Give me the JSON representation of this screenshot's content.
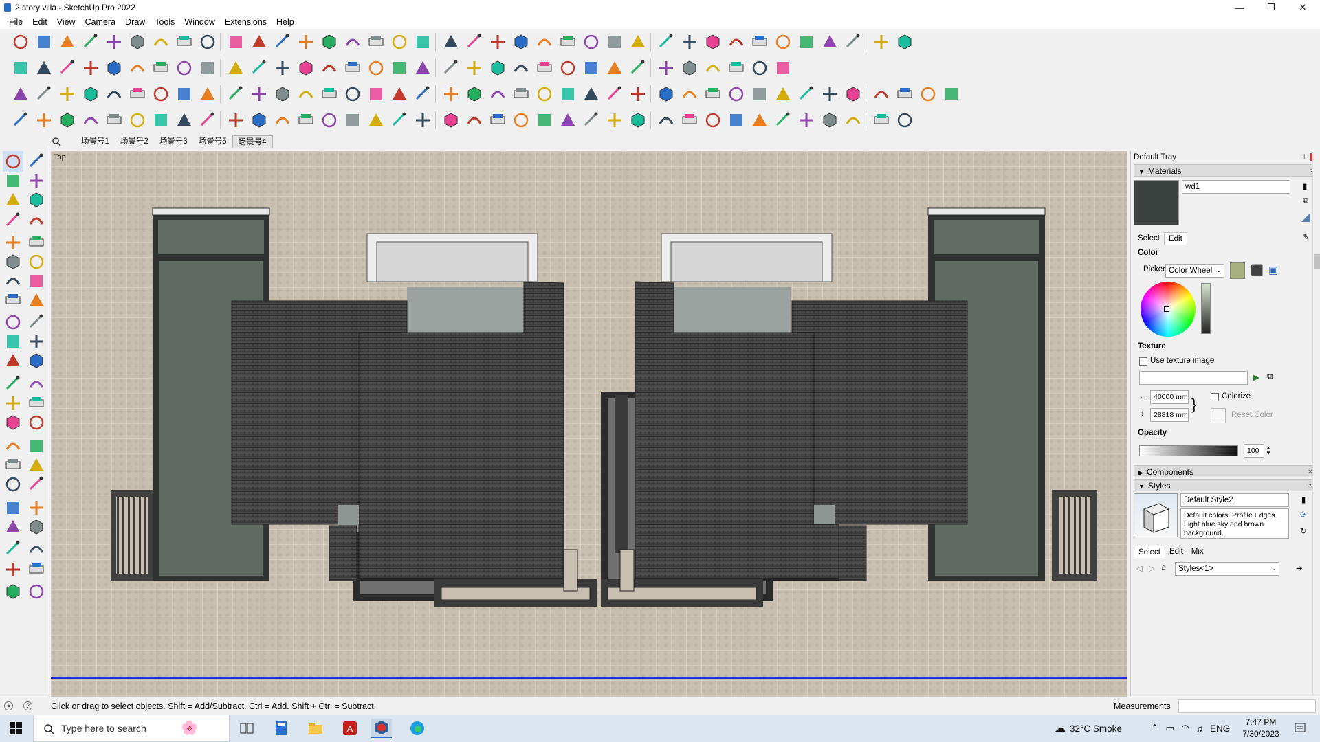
{
  "window": {
    "title": "2 story villa - SketchUp Pro 2022",
    "minimize": "—",
    "restore": "❐",
    "close": "✕"
  },
  "menu": [
    "File",
    "Edit",
    "View",
    "Camera",
    "Draw",
    "Tools",
    "Window",
    "Extensions",
    "Help"
  ],
  "scenes": {
    "tabs": [
      "场景号1",
      "场景号2",
      "场景号3",
      "场景号5",
      "场景号4"
    ],
    "active_index": 4
  },
  "viewport": {
    "view_label": "Top"
  },
  "tray": {
    "title": "Default Tray",
    "materials": {
      "header": "Materials",
      "name": "wd1",
      "swatch_color": "#3c4240",
      "tab_select": "Select",
      "tab_edit": "Edit",
      "color_label": "Color",
      "picker_label": "Picker:",
      "picker_value": "Color Wheel",
      "texture_label": "Texture",
      "use_texture": "Use texture image",
      "width": "40000 mm",
      "height": "28818 mm",
      "colorize": "Colorize",
      "reset_color": "Reset Color",
      "opacity_label": "Opacity",
      "opacity_value": "100"
    },
    "components": {
      "header": "Components"
    },
    "styles": {
      "header": "Styles",
      "name": "Default Style2",
      "description": "Default colors. Profile Edges. Light blue sky and brown background.",
      "tab_select": "Select",
      "tab_edit": "Edit",
      "tab_mix": "Mix",
      "collection": "Styles<1>"
    }
  },
  "status": {
    "hint": "Click or drag to select objects. Shift = Add/Subtract. Ctrl = Add. Shift + Ctrl = Subtract.",
    "measurements_label": "Measurements"
  },
  "taskbar": {
    "search_placeholder": "Type here to search",
    "weather": "32°C  Smoke",
    "language": "ENG",
    "time": "7:47 PM",
    "date": "7/30/2023"
  }
}
